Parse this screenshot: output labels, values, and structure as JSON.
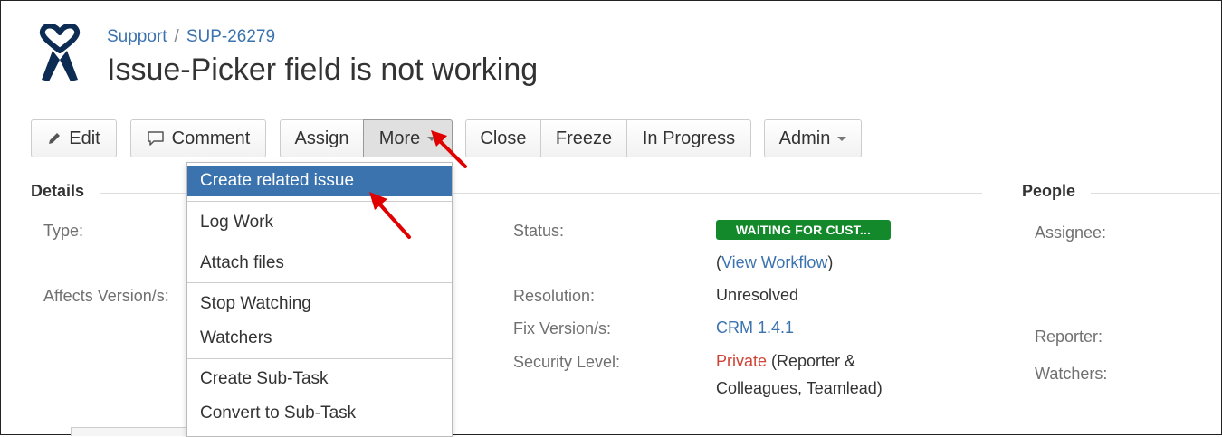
{
  "breadcrumb": {
    "project": "Support",
    "separator": "/",
    "issue_key": "SUP-26279"
  },
  "issue": {
    "title": "Issue-Picker field is not working"
  },
  "toolbar": {
    "edit": "Edit",
    "comment": "Comment",
    "assign": "Assign",
    "more": "More",
    "close": "Close",
    "freeze": "Freeze",
    "in_progress": "In Progress",
    "admin": "Admin"
  },
  "more_menu": {
    "items": [
      "Create related issue",
      "Log Work",
      "Attach files",
      "Stop Watching",
      "Watchers",
      "Create Sub-Task",
      "Convert to Sub-Task"
    ]
  },
  "details": {
    "heading": "Details",
    "type_label": "Type:",
    "affects_label": "Affects Version/s:",
    "status_label": "Status:",
    "status_value": "WAITING FOR CUST...",
    "view_workflow_open": "(",
    "view_workflow": "View Workflow",
    "view_workflow_close": ")",
    "resolution_label": "Resolution:",
    "resolution_value": "Unresolved",
    "fix_label": "Fix Version/s:",
    "fix_value": "CRM 1.4.1",
    "security_label": "Security Level:",
    "security_private": "Private",
    "security_rest_line1": " (Reporter &",
    "security_rest_line2": "Colleagues, Teamlead)"
  },
  "people": {
    "heading": "People",
    "assignee_label": "Assignee:",
    "reporter_label": "Reporter:",
    "watchers_label": "Watchers:"
  },
  "colors": {
    "link": "#3b73af",
    "status_green": "#14892c",
    "private_red": "#d04437",
    "annotation_arrow": "#e00000"
  },
  "icons": {
    "logo": "heart-ribbon-logo",
    "edit": "pencil-icon",
    "comment": "speech-bubble-icon",
    "more": "chevron-down-icon",
    "admin": "chevron-down-icon"
  }
}
